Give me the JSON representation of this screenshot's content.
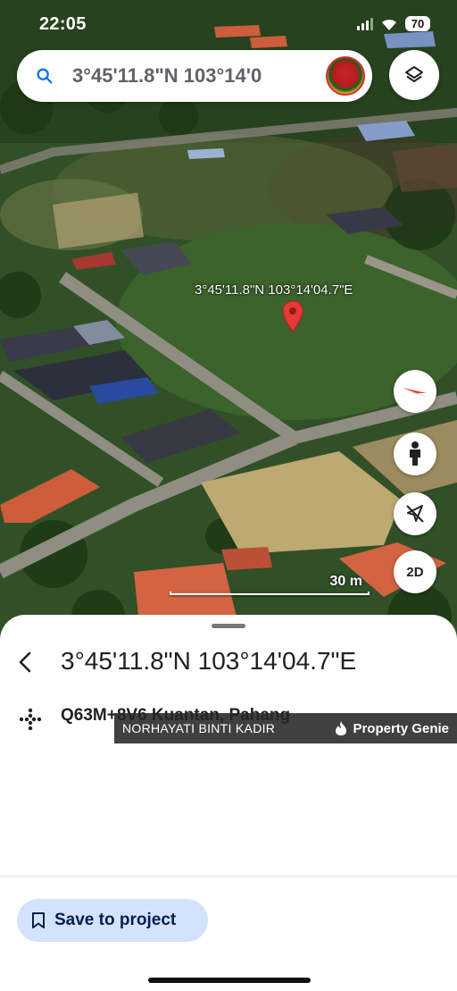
{
  "status_bar": {
    "time": "22:05",
    "battery": "70"
  },
  "search": {
    "query": "3°45'11.8\"N 103°14'0",
    "icon": "search-icon"
  },
  "map": {
    "pin_label": "3°45'11.8\"N 103°14'04.7\"E",
    "scale_label": "30 m",
    "view_mode_label": "2D",
    "pin_color": "#e53935"
  },
  "place": {
    "title": "3°45'11.8\"N 103°14'04.7\"E",
    "plus_code": "Q63M+8V6 Kuantan, Pahang"
  },
  "watermark": {
    "name": "NORHAYATI BINTI KADIR",
    "brand": "Property Genie"
  },
  "actions": {
    "save_label": "Save to project",
    "accent": "#d3e3fd"
  }
}
